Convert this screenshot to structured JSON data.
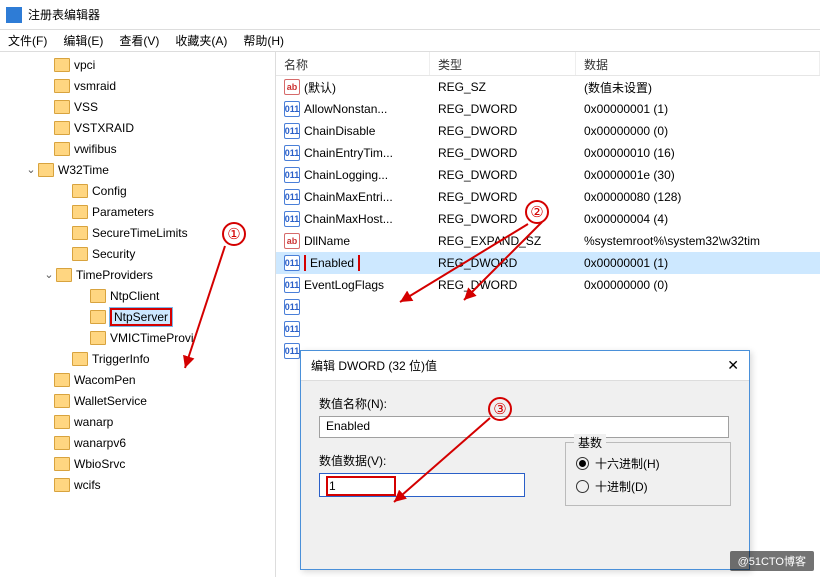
{
  "window": {
    "title": "注册表编辑器"
  },
  "menu": {
    "file": "文件(F)",
    "edit": "编辑(E)",
    "view": "查看(V)",
    "fav": "收藏夹(A)",
    "help": "帮助(H)"
  },
  "tree": [
    {
      "indent": 3,
      "toggle": "",
      "label": "vpci"
    },
    {
      "indent": 3,
      "toggle": "",
      "label": "vsmraid"
    },
    {
      "indent": 3,
      "toggle": "",
      "label": "VSS"
    },
    {
      "indent": 3,
      "toggle": "",
      "label": "VSTXRAID"
    },
    {
      "indent": 3,
      "toggle": "",
      "label": "vwifibus"
    },
    {
      "indent": 2,
      "toggle": "v",
      "label": "W32Time"
    },
    {
      "indent": 4,
      "toggle": "",
      "label": "Config"
    },
    {
      "indent": 4,
      "toggle": "",
      "label": "Parameters"
    },
    {
      "indent": 4,
      "toggle": "",
      "label": "SecureTimeLimits"
    },
    {
      "indent": 4,
      "toggle": "",
      "label": "Security"
    },
    {
      "indent": 3,
      "toggle": "v",
      "label": "TimeProviders"
    },
    {
      "indent": 5,
      "toggle": "",
      "label": "NtpClient"
    },
    {
      "indent": 5,
      "toggle": "",
      "label": "NtpServer",
      "highlight": true,
      "selected": true
    },
    {
      "indent": 5,
      "toggle": "",
      "label": "VMICTimeProvi"
    },
    {
      "indent": 4,
      "toggle": "",
      "label": "TriggerInfo"
    },
    {
      "indent": 3,
      "toggle": "",
      "label": "WacomPen"
    },
    {
      "indent": 3,
      "toggle": "",
      "label": "WalletService"
    },
    {
      "indent": 3,
      "toggle": "",
      "label": "wanarp"
    },
    {
      "indent": 3,
      "toggle": "",
      "label": "wanarpv6"
    },
    {
      "indent": 3,
      "toggle": "",
      "label": "WbioSrvc"
    },
    {
      "indent": 3,
      "toggle": "",
      "label": "wcifs"
    }
  ],
  "tree_lines": [
    3,
    3,
    3,
    3,
    3,
    2,
    4,
    4,
    4,
    4,
    3,
    5,
    5,
    5,
    4,
    3,
    3,
    3,
    3,
    3,
    3
  ],
  "columns": {
    "name": "名称",
    "type": "类型",
    "data": "数据"
  },
  "rows": [
    {
      "ico": "sz",
      "name": "(默认)",
      "type": "REG_SZ",
      "data": "(数值未设置)"
    },
    {
      "ico": "dw",
      "name": "AllowNonstan...",
      "type": "REG_DWORD",
      "data": "0x00000001 (1)"
    },
    {
      "ico": "dw",
      "name": "ChainDisable",
      "type": "REG_DWORD",
      "data": "0x00000000 (0)"
    },
    {
      "ico": "dw",
      "name": "ChainEntryTim...",
      "type": "REG_DWORD",
      "data": "0x00000010 (16)"
    },
    {
      "ico": "dw",
      "name": "ChainLogging...",
      "type": "REG_DWORD",
      "data": "0x0000001e (30)"
    },
    {
      "ico": "dw",
      "name": "ChainMaxEntri...",
      "type": "REG_DWORD",
      "data": "0x00000080 (128)"
    },
    {
      "ico": "dw",
      "name": "ChainMaxHost...",
      "type": "REG_DWORD",
      "data": "0x00000004 (4)"
    },
    {
      "ico": "sz",
      "name": "DllName",
      "type": "REG_EXPAND_SZ",
      "data": "%systemroot%\\system32\\w32tim"
    },
    {
      "ico": "dw",
      "name": "Enabled",
      "type": "REG_DWORD",
      "data": "0x00000001 (1)",
      "selected": true,
      "highlight": true
    },
    {
      "ico": "dw",
      "name": "EventLogFlags",
      "type": "REG_DWORD",
      "data": "0x00000000 (0)"
    },
    {
      "ico": "dw",
      "name": "",
      "type": "",
      "data": ""
    },
    {
      "ico": "dw",
      "name": "",
      "type": "",
      "data": ""
    },
    {
      "ico": "dw",
      "name": "",
      "type": "",
      "data": ""
    }
  ],
  "dialog": {
    "title": "编辑 DWORD (32 位)值",
    "name_label": "数值名称(N):",
    "name_value": "Enabled",
    "data_label": "数值数据(V):",
    "data_value": "1",
    "radix_label": "基数",
    "radix_hex": "十六进制(H)",
    "radix_dec": "十进制(D)"
  },
  "annotations": {
    "a1": "①",
    "a2": "②",
    "a3": "③"
  },
  "watermark": "@51CTO博客"
}
